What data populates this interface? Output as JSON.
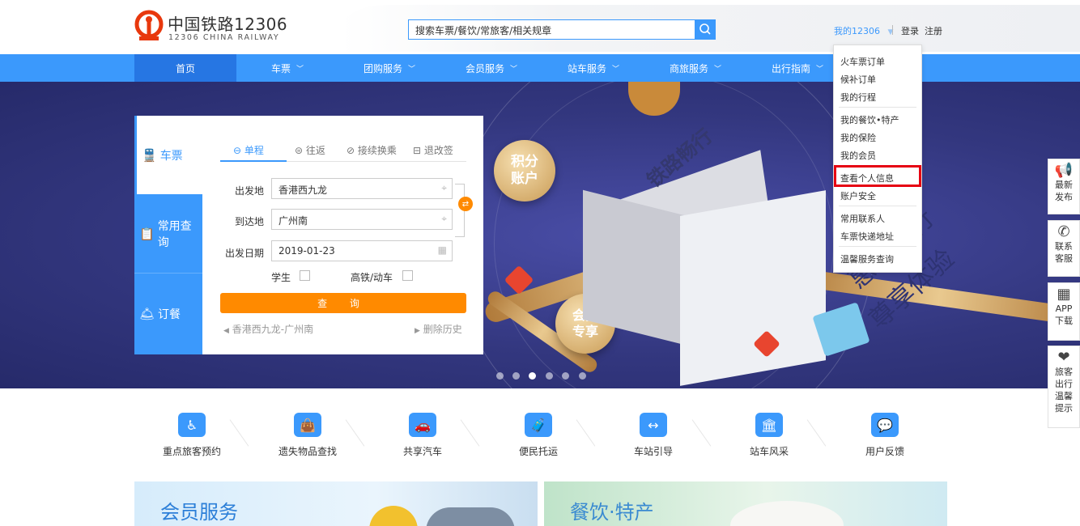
{
  "header": {
    "logo_cn": "中国铁路12306",
    "logo_en": "12306 CHINA RAILWAY",
    "search_placeholder": "搜索车票/餐饮/常旅客/相关规章",
    "my_12306": "我的12306",
    "login": "登录",
    "register": "注册"
  },
  "nav": [
    {
      "label": "首页",
      "caret": false
    },
    {
      "label": "车票",
      "caret": true
    },
    {
      "label": "团购服务",
      "caret": true
    },
    {
      "label": "会员服务",
      "caret": true
    },
    {
      "label": "站车服务",
      "caret": true
    },
    {
      "label": "商旅服务",
      "caret": true
    },
    {
      "label": "出行指南",
      "caret": true
    }
  ],
  "dropdown": [
    "火车票订单",
    "候补订单",
    "我的行程",
    "我的餐饮•特产",
    "我的保险",
    "我的会员",
    "查看个人信息",
    "账户安全",
    "常用联系人",
    "车票快递地址",
    "温馨服务查询"
  ],
  "booking": {
    "side_tabs": [
      "车票",
      "常用查询",
      "订餐"
    ],
    "trip_tabs": [
      "单程",
      "往返",
      "接续换乘",
      "退改签"
    ],
    "from_label": "出发地",
    "from_value": "香港西九龙",
    "to_label": "到达地",
    "to_value": "广州南",
    "date_label": "出发日期",
    "date_value": "2019-01-23",
    "student": "学生",
    "gaotie": "高铁/动车",
    "query": "查 询",
    "history": "香港西九龙-广州南",
    "clear_history": "删除历史"
  },
  "hero": {
    "cube_title": "铁路畅行",
    "cube_line1": "惠想出行",
    "cube_line2": "尊享体验",
    "badge1": [
      "积分",
      "账户"
    ],
    "badge2": [
      "会员",
      "专享"
    ],
    "dots": 6,
    "active_dot": 3
  },
  "toolbar": [
    {
      "icon": "megaphone-icon",
      "glyph": "📢",
      "label": "最新发布"
    },
    {
      "icon": "phone-icon",
      "glyph": "✆",
      "label": "联系客服"
    },
    {
      "icon": "qrcode-icon",
      "glyph": "▦",
      "label": "APP下载"
    },
    {
      "icon": "heart-hand-icon",
      "glyph": "❤",
      "label": "旅客出行温馨提示"
    }
  ],
  "services": [
    {
      "label": "重点旅客预约",
      "glyph": "♿"
    },
    {
      "label": "遗失物品查找",
      "glyph": "👜"
    },
    {
      "label": "共享汽车",
      "glyph": "🚗"
    },
    {
      "label": "便民托运",
      "glyph": "🧳"
    },
    {
      "label": "车站引导",
      "glyph": "↔"
    },
    {
      "label": "站车风采",
      "glyph": "🏛"
    },
    {
      "label": "用户反馈",
      "glyph": "💬"
    }
  ],
  "promos": [
    "会员服务",
    "餐饮·特产"
  ]
}
